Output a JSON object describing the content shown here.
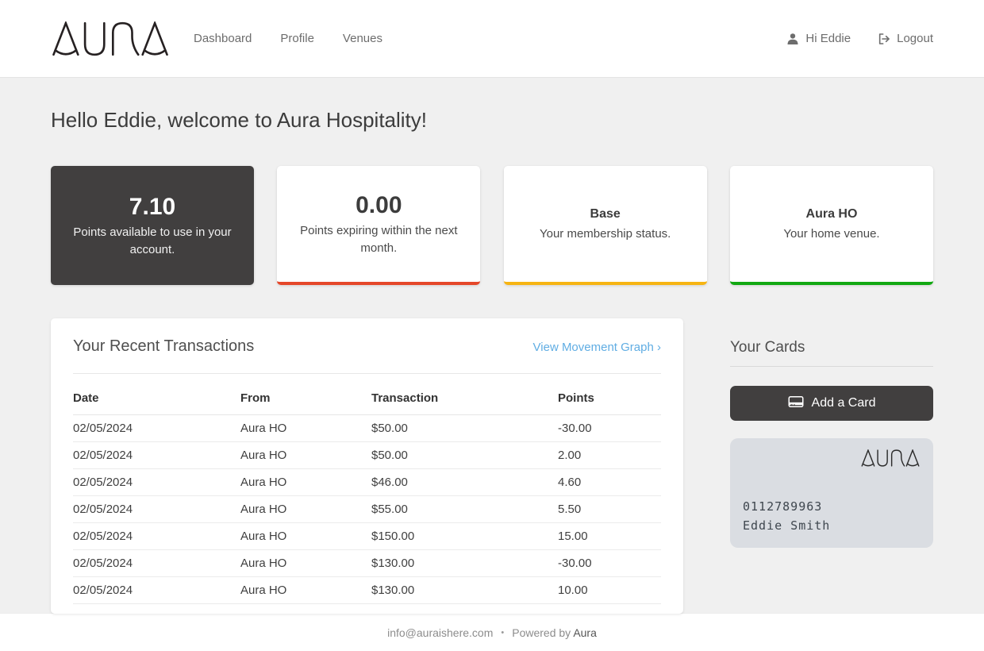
{
  "brand": {
    "logo_text": "AURA"
  },
  "navbar": {
    "links": [
      {
        "label": "Dashboard"
      },
      {
        "label": "Profile"
      },
      {
        "label": "Venues"
      }
    ],
    "user_greeting": "Hi Eddie",
    "logout_label": "Logout"
  },
  "greeting": "Hello Eddie, welcome to Aura Hospitality!",
  "stat_cards": [
    {
      "value": "7.10",
      "caption": "Points available to use in your account.",
      "style": "dark",
      "background": "#413f3f"
    },
    {
      "value": "0.00",
      "caption": "Points expiring within the next month.",
      "accent": "#e5472a"
    },
    {
      "title": "Base",
      "caption": "Your membership status.",
      "accent": "#f6b413"
    },
    {
      "title": "Aura HO",
      "caption": "Your home venue.",
      "accent": "#12a812"
    }
  ],
  "transactions": {
    "title": "Your Recent Transactions",
    "link_label": "View Movement Graph ›",
    "link_color": "#60ade3",
    "columns": [
      "Date",
      "From",
      "Transaction",
      "Points"
    ],
    "rows": [
      {
        "date": "02/05/2024",
        "from": "Aura HO",
        "transaction": "$50.00",
        "points": "-30.00"
      },
      {
        "date": "02/05/2024",
        "from": "Aura HO",
        "transaction": "$50.00",
        "points": "2.00"
      },
      {
        "date": "02/05/2024",
        "from": "Aura HO",
        "transaction": "$46.00",
        "points": "4.60"
      },
      {
        "date": "02/05/2024",
        "from": "Aura HO",
        "transaction": "$55.00",
        "points": "5.50"
      },
      {
        "date": "02/05/2024",
        "from": "Aura HO",
        "transaction": "$150.00",
        "points": "15.00"
      },
      {
        "date": "02/05/2024",
        "from": "Aura HO",
        "transaction": "$130.00",
        "points": "-30.00"
      },
      {
        "date": "02/05/2024",
        "from": "Aura HO",
        "transaction": "$130.00",
        "points": "10.00"
      }
    ]
  },
  "cards_section": {
    "title": "Your Cards",
    "add_button_label": "Add a Card",
    "member_card": {
      "brand": "AURA",
      "number": "0112789963",
      "holder": "Eddie Smith",
      "background": "#dadde2"
    }
  },
  "footer": {
    "email": "info@auraishere.com",
    "separator": "•",
    "powered_prefix": "Powered by",
    "powered_brand": "Aura"
  },
  "icons": {
    "user-icon": "person silhouette",
    "logout-icon": "sign-out arrow",
    "credit-card-icon": "credit card",
    "aura-logo": "stylized AURA wordmark"
  }
}
